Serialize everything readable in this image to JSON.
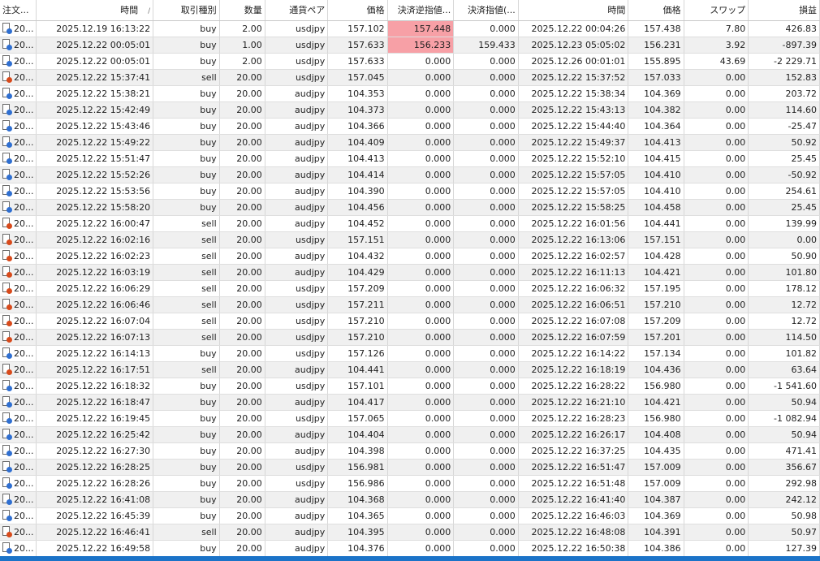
{
  "columns": [
    {
      "label": "注文...",
      "align": "l",
      "w": 44
    },
    {
      "label": "時間",
      "align": "r",
      "w": 141
    },
    {
      "label": "取引種別",
      "align": "r",
      "w": 80
    },
    {
      "label": "数量",
      "align": "r",
      "w": 55
    },
    {
      "label": "通貨ペア",
      "align": "r",
      "w": 76
    },
    {
      "label": "価格",
      "align": "r",
      "w": 72
    },
    {
      "label": "決済逆指値...",
      "align": "r",
      "w": 80
    },
    {
      "label": "決済指値(...",
      "align": "r",
      "w": 78
    },
    {
      "label": "時間",
      "align": "r",
      "w": 133
    },
    {
      "label": "価格",
      "align": "r",
      "w": 67
    },
    {
      "label": "スワップ",
      "align": "r",
      "w": 78
    },
    {
      "label": "損益",
      "align": "r",
      "w": 86
    }
  ],
  "sort_indicator": "/",
  "accent_color": "#1b73c8",
  "highlight_color": "#f7a0a6",
  "rows": [
    {
      "ticket": "20...",
      "open_time": "2025.12.19 16:13:22",
      "type": "buy",
      "volume": "2.00",
      "symbol": "usdjpy",
      "price": "157.102",
      "sl": "157.448",
      "tp": "0.000",
      "close_time": "2025.12.22 00:04:26",
      "close_price": "157.438",
      "swap": "7.80",
      "profit": "426.83",
      "sl_hl": true
    },
    {
      "ticket": "20...",
      "open_time": "2025.12.22 00:05:01",
      "type": "buy",
      "volume": "1.00",
      "symbol": "usdjpy",
      "price": "157.633",
      "sl": "156.233",
      "tp": "159.433",
      "close_time": "2025.12.23 05:05:02",
      "close_price": "156.231",
      "swap": "3.92",
      "profit": "-897.39",
      "sl_hl": true
    },
    {
      "ticket": "20...",
      "open_time": "2025.12.22 00:05:01",
      "type": "buy",
      "volume": "2.00",
      "symbol": "usdjpy",
      "price": "157.633",
      "sl": "0.000",
      "tp": "0.000",
      "close_time": "2025.12.26 00:01:01",
      "close_price": "155.895",
      "swap": "43.69",
      "profit": "-2 229.71"
    },
    {
      "ticket": "20...",
      "open_time": "2025.12.22 15:37:41",
      "type": "sell",
      "volume": "20.00",
      "symbol": "usdjpy",
      "price": "157.045",
      "sl": "0.000",
      "tp": "0.000",
      "close_time": "2025.12.22 15:37:52",
      "close_price": "157.033",
      "swap": "0.00",
      "profit": "152.83"
    },
    {
      "ticket": "20...",
      "open_time": "2025.12.22 15:38:21",
      "type": "buy",
      "volume": "20.00",
      "symbol": "audjpy",
      "price": "104.353",
      "sl": "0.000",
      "tp": "0.000",
      "close_time": "2025.12.22 15:38:34",
      "close_price": "104.369",
      "swap": "0.00",
      "profit": "203.72"
    },
    {
      "ticket": "20...",
      "open_time": "2025.12.22 15:42:49",
      "type": "buy",
      "volume": "20.00",
      "symbol": "audjpy",
      "price": "104.373",
      "sl": "0.000",
      "tp": "0.000",
      "close_time": "2025.12.22 15:43:13",
      "close_price": "104.382",
      "swap": "0.00",
      "profit": "114.60"
    },
    {
      "ticket": "20...",
      "open_time": "2025.12.22 15:43:46",
      "type": "buy",
      "volume": "20.00",
      "symbol": "audjpy",
      "price": "104.366",
      "sl": "0.000",
      "tp": "0.000",
      "close_time": "2025.12.22 15:44:40",
      "close_price": "104.364",
      "swap": "0.00",
      "profit": "-25.47"
    },
    {
      "ticket": "20...",
      "open_time": "2025.12.22 15:49:22",
      "type": "buy",
      "volume": "20.00",
      "symbol": "audjpy",
      "price": "104.409",
      "sl": "0.000",
      "tp": "0.000",
      "close_time": "2025.12.22 15:49:37",
      "close_price": "104.413",
      "swap": "0.00",
      "profit": "50.92"
    },
    {
      "ticket": "20...",
      "open_time": "2025.12.22 15:51:47",
      "type": "buy",
      "volume": "20.00",
      "symbol": "audjpy",
      "price": "104.413",
      "sl": "0.000",
      "tp": "0.000",
      "close_time": "2025.12.22 15:52:10",
      "close_price": "104.415",
      "swap": "0.00",
      "profit": "25.45"
    },
    {
      "ticket": "20...",
      "open_time": "2025.12.22 15:52:26",
      "type": "buy",
      "volume": "20.00",
      "symbol": "audjpy",
      "price": "104.414",
      "sl": "0.000",
      "tp": "0.000",
      "close_time": "2025.12.22 15:57:05",
      "close_price": "104.410",
      "swap": "0.00",
      "profit": "-50.92"
    },
    {
      "ticket": "20...",
      "open_time": "2025.12.22 15:53:56",
      "type": "buy",
      "volume": "20.00",
      "symbol": "audjpy",
      "price": "104.390",
      "sl": "0.000",
      "tp": "0.000",
      "close_time": "2025.12.22 15:57:05",
      "close_price": "104.410",
      "swap": "0.00",
      "profit": "254.61"
    },
    {
      "ticket": "20...",
      "open_time": "2025.12.22 15:58:20",
      "type": "buy",
      "volume": "20.00",
      "symbol": "audjpy",
      "price": "104.456",
      "sl": "0.000",
      "tp": "0.000",
      "close_time": "2025.12.22 15:58:25",
      "close_price": "104.458",
      "swap": "0.00",
      "profit": "25.45"
    },
    {
      "ticket": "20...",
      "open_time": "2025.12.22 16:00:47",
      "type": "sell",
      "volume": "20.00",
      "symbol": "audjpy",
      "price": "104.452",
      "sl": "0.000",
      "tp": "0.000",
      "close_time": "2025.12.22 16:01:56",
      "close_price": "104.441",
      "swap": "0.00",
      "profit": "139.99"
    },
    {
      "ticket": "20...",
      "open_time": "2025.12.22 16:02:16",
      "type": "sell",
      "volume": "20.00",
      "symbol": "usdjpy",
      "price": "157.151",
      "sl": "0.000",
      "tp": "0.000",
      "close_time": "2025.12.22 16:13:06",
      "close_price": "157.151",
      "swap": "0.00",
      "profit": "0.00"
    },
    {
      "ticket": "20...",
      "open_time": "2025.12.22 16:02:23",
      "type": "sell",
      "volume": "20.00",
      "symbol": "audjpy",
      "price": "104.432",
      "sl": "0.000",
      "tp": "0.000",
      "close_time": "2025.12.22 16:02:57",
      "close_price": "104.428",
      "swap": "0.00",
      "profit": "50.90"
    },
    {
      "ticket": "20...",
      "open_time": "2025.12.22 16:03:19",
      "type": "sell",
      "volume": "20.00",
      "symbol": "audjpy",
      "price": "104.429",
      "sl": "0.000",
      "tp": "0.000",
      "close_time": "2025.12.22 16:11:13",
      "close_price": "104.421",
      "swap": "0.00",
      "profit": "101.80"
    },
    {
      "ticket": "20...",
      "open_time": "2025.12.22 16:06:29",
      "type": "sell",
      "volume": "20.00",
      "symbol": "usdjpy",
      "price": "157.209",
      "sl": "0.000",
      "tp": "0.000",
      "close_time": "2025.12.22 16:06:32",
      "close_price": "157.195",
      "swap": "0.00",
      "profit": "178.12"
    },
    {
      "ticket": "20...",
      "open_time": "2025.12.22 16:06:46",
      "type": "sell",
      "volume": "20.00",
      "symbol": "usdjpy",
      "price": "157.211",
      "sl": "0.000",
      "tp": "0.000",
      "close_time": "2025.12.22 16:06:51",
      "close_price": "157.210",
      "swap": "0.00",
      "profit": "12.72"
    },
    {
      "ticket": "20...",
      "open_time": "2025.12.22 16:07:04",
      "type": "sell",
      "volume": "20.00",
      "symbol": "usdjpy",
      "price": "157.210",
      "sl": "0.000",
      "tp": "0.000",
      "close_time": "2025.12.22 16:07:08",
      "close_price": "157.209",
      "swap": "0.00",
      "profit": "12.72"
    },
    {
      "ticket": "20...",
      "open_time": "2025.12.22 16:07:13",
      "type": "sell",
      "volume": "20.00",
      "symbol": "usdjpy",
      "price": "157.210",
      "sl": "0.000",
      "tp": "0.000",
      "close_time": "2025.12.22 16:07:59",
      "close_price": "157.201",
      "swap": "0.00",
      "profit": "114.50"
    },
    {
      "ticket": "20...",
      "open_time": "2025.12.22 16:14:13",
      "type": "buy",
      "volume": "20.00",
      "symbol": "usdjpy",
      "price": "157.126",
      "sl": "0.000",
      "tp": "0.000",
      "close_time": "2025.12.22 16:14:22",
      "close_price": "157.134",
      "swap": "0.00",
      "profit": "101.82"
    },
    {
      "ticket": "20...",
      "open_time": "2025.12.22 16:17:51",
      "type": "sell",
      "volume": "20.00",
      "symbol": "audjpy",
      "price": "104.441",
      "sl": "0.000",
      "tp": "0.000",
      "close_time": "2025.12.22 16:18:19",
      "close_price": "104.436",
      "swap": "0.00",
      "profit": "63.64"
    },
    {
      "ticket": "20...",
      "open_time": "2025.12.22 16:18:32",
      "type": "buy",
      "volume": "20.00",
      "symbol": "usdjpy",
      "price": "157.101",
      "sl": "0.000",
      "tp": "0.000",
      "close_time": "2025.12.22 16:28:22",
      "close_price": "156.980",
      "swap": "0.00",
      "profit": "-1 541.60"
    },
    {
      "ticket": "20...",
      "open_time": "2025.12.22 16:18:47",
      "type": "buy",
      "volume": "20.00",
      "symbol": "audjpy",
      "price": "104.417",
      "sl": "0.000",
      "tp": "0.000",
      "close_time": "2025.12.22 16:21:10",
      "close_price": "104.421",
      "swap": "0.00",
      "profit": "50.94"
    },
    {
      "ticket": "20...",
      "open_time": "2025.12.22 16:19:45",
      "type": "buy",
      "volume": "20.00",
      "symbol": "usdjpy",
      "price": "157.065",
      "sl": "0.000",
      "tp": "0.000",
      "close_time": "2025.12.22 16:28:23",
      "close_price": "156.980",
      "swap": "0.00",
      "profit": "-1 082.94"
    },
    {
      "ticket": "20...",
      "open_time": "2025.12.22 16:25:42",
      "type": "buy",
      "volume": "20.00",
      "symbol": "audjpy",
      "price": "104.404",
      "sl": "0.000",
      "tp": "0.000",
      "close_time": "2025.12.22 16:26:17",
      "close_price": "104.408",
      "swap": "0.00",
      "profit": "50.94"
    },
    {
      "ticket": "20...",
      "open_time": "2025.12.22 16:27:30",
      "type": "buy",
      "volume": "20.00",
      "symbol": "audjpy",
      "price": "104.398",
      "sl": "0.000",
      "tp": "0.000",
      "close_time": "2025.12.22 16:37:25",
      "close_price": "104.435",
      "swap": "0.00",
      "profit": "471.41"
    },
    {
      "ticket": "20...",
      "open_time": "2025.12.22 16:28:25",
      "type": "buy",
      "volume": "20.00",
      "symbol": "usdjpy",
      "price": "156.981",
      "sl": "0.000",
      "tp": "0.000",
      "close_time": "2025.12.22 16:51:47",
      "close_price": "157.009",
      "swap": "0.00",
      "profit": "356.67"
    },
    {
      "ticket": "20...",
      "open_time": "2025.12.22 16:28:26",
      "type": "buy",
      "volume": "20.00",
      "symbol": "usdjpy",
      "price": "156.986",
      "sl": "0.000",
      "tp": "0.000",
      "close_time": "2025.12.22 16:51:48",
      "close_price": "157.009",
      "swap": "0.00",
      "profit": "292.98"
    },
    {
      "ticket": "20...",
      "open_time": "2025.12.22 16:41:08",
      "type": "buy",
      "volume": "20.00",
      "symbol": "audjpy",
      "price": "104.368",
      "sl": "0.000",
      "tp": "0.000",
      "close_time": "2025.12.22 16:41:40",
      "close_price": "104.387",
      "swap": "0.00",
      "profit": "242.12"
    },
    {
      "ticket": "20...",
      "open_time": "2025.12.22 16:45:39",
      "type": "buy",
      "volume": "20.00",
      "symbol": "audjpy",
      "price": "104.365",
      "sl": "0.000",
      "tp": "0.000",
      "close_time": "2025.12.22 16:46:03",
      "close_price": "104.369",
      "swap": "0.00",
      "profit": "50.98"
    },
    {
      "ticket": "20...",
      "open_time": "2025.12.22 16:46:41",
      "type": "sell",
      "volume": "20.00",
      "symbol": "audjpy",
      "price": "104.395",
      "sl": "0.000",
      "tp": "0.000",
      "close_time": "2025.12.22 16:48:08",
      "close_price": "104.391",
      "swap": "0.00",
      "profit": "50.97"
    },
    {
      "ticket": "20...",
      "open_time": "2025.12.22 16:49:58",
      "type": "buy",
      "volume": "20.00",
      "symbol": "audjpy",
      "price": "104.376",
      "sl": "0.000",
      "tp": "0.000",
      "close_time": "2025.12.22 16:50:38",
      "close_price": "104.386",
      "swap": "0.00",
      "profit": "127.39"
    }
  ]
}
